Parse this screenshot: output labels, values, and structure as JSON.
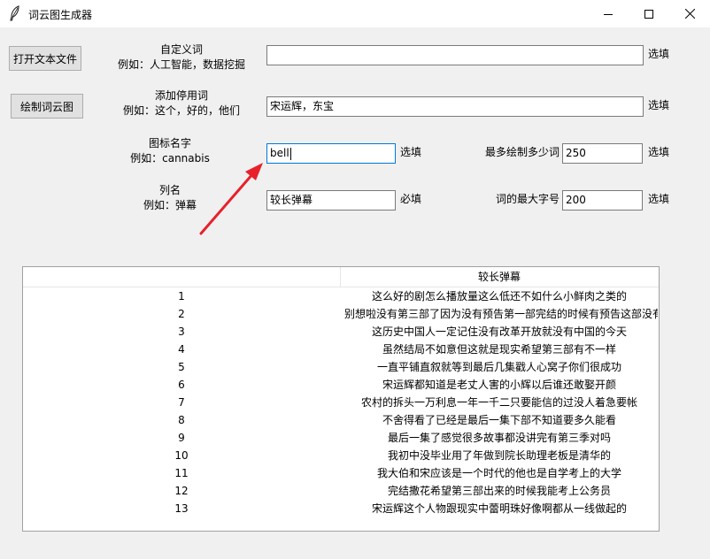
{
  "window": {
    "title": "词云图生成器"
  },
  "buttons": {
    "open_file": "打开文本文件",
    "draw": "绘制词云图"
  },
  "form": {
    "custom_words": {
      "label": "自定义词",
      "example": "例如：人工智能，数据挖掘",
      "value": "",
      "hint": "选填"
    },
    "stopwords": {
      "label": "添加停用词",
      "example": "例如：这个，好的，他们",
      "value": "宋运辉，东宝",
      "hint": "选填"
    },
    "icon_name": {
      "label": "图标名字",
      "example": "例如：cannabis",
      "value": "bell",
      "hint": "选填"
    },
    "column_name": {
      "label": "列名",
      "example": "例如：弹幕",
      "value": "较长弹幕",
      "hint": "必填"
    },
    "max_words": {
      "label": "最多绘制多少词",
      "value": "250",
      "hint": "选填"
    },
    "max_font_size": {
      "label": "词的最大字号",
      "value": "200",
      "hint": "选填"
    }
  },
  "table": {
    "column_header": "较长弹幕",
    "rows": [
      {
        "index": "1",
        "text": "这么好的剧怎么播放量这么低还不如什么小鲜肉之类的"
      },
      {
        "index": "2",
        "text": "别想啦没有第三部了因为没有预告第一部完结的时候有预告这部没有"
      },
      {
        "index": "3",
        "text": "这历史中国人一定记住没有改革开放就没有中国的今天"
      },
      {
        "index": "4",
        "text": "虽然结局不如意但这就是现实希望第三部有不一样"
      },
      {
        "index": "5",
        "text": "一直平铺直叙就等到最后几集戳人心窝子你们很成功"
      },
      {
        "index": "6",
        "text": "宋运辉都知道是老丈人害的小辉以后谁还敢娶开颜"
      },
      {
        "index": "7",
        "text": "农村的拆头一万利息一年一千二只要能信的过没人着急要帐"
      },
      {
        "index": "8",
        "text": "不舍得看了已经是最后一集下部不知道要多久能看"
      },
      {
        "index": "9",
        "text": "最后一集了感觉很多故事都没讲完有第三季对吗"
      },
      {
        "index": "10",
        "text": "我初中没毕业用了年做到院长助理老板是清华的"
      },
      {
        "index": "11",
        "text": "我大伯和宋应该是一个时代的他也是自学考上的大学"
      },
      {
        "index": "12",
        "text": "完结撒花希望第三部出来的时候我能考上公务员"
      },
      {
        "index": "13",
        "text": "宋运辉这个人物跟现实中蕾明珠好像啊都从一线做起的"
      }
    ]
  },
  "colors": {
    "arrow": "#e8202a",
    "focus_border": "#0078d7"
  },
  "icons": {
    "app": "feather-icon",
    "minimize": "minimize-icon",
    "maximize": "maximize-icon",
    "close": "close-icon"
  }
}
